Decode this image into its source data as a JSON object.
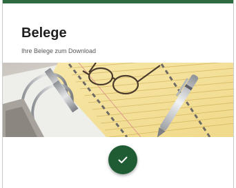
{
  "card": {
    "title": "Belege",
    "subtitle": "Ihre Belege zum Download"
  },
  "hero_image": {
    "subject": "binder-paper-glasses-pen-photo"
  },
  "action": {
    "icon": "check-icon"
  },
  "colors": {
    "accent_bar": "#2e6a3f",
    "button": "#1f5c34",
    "title": "#1f1f1f",
    "subtitle": "#555555"
  }
}
